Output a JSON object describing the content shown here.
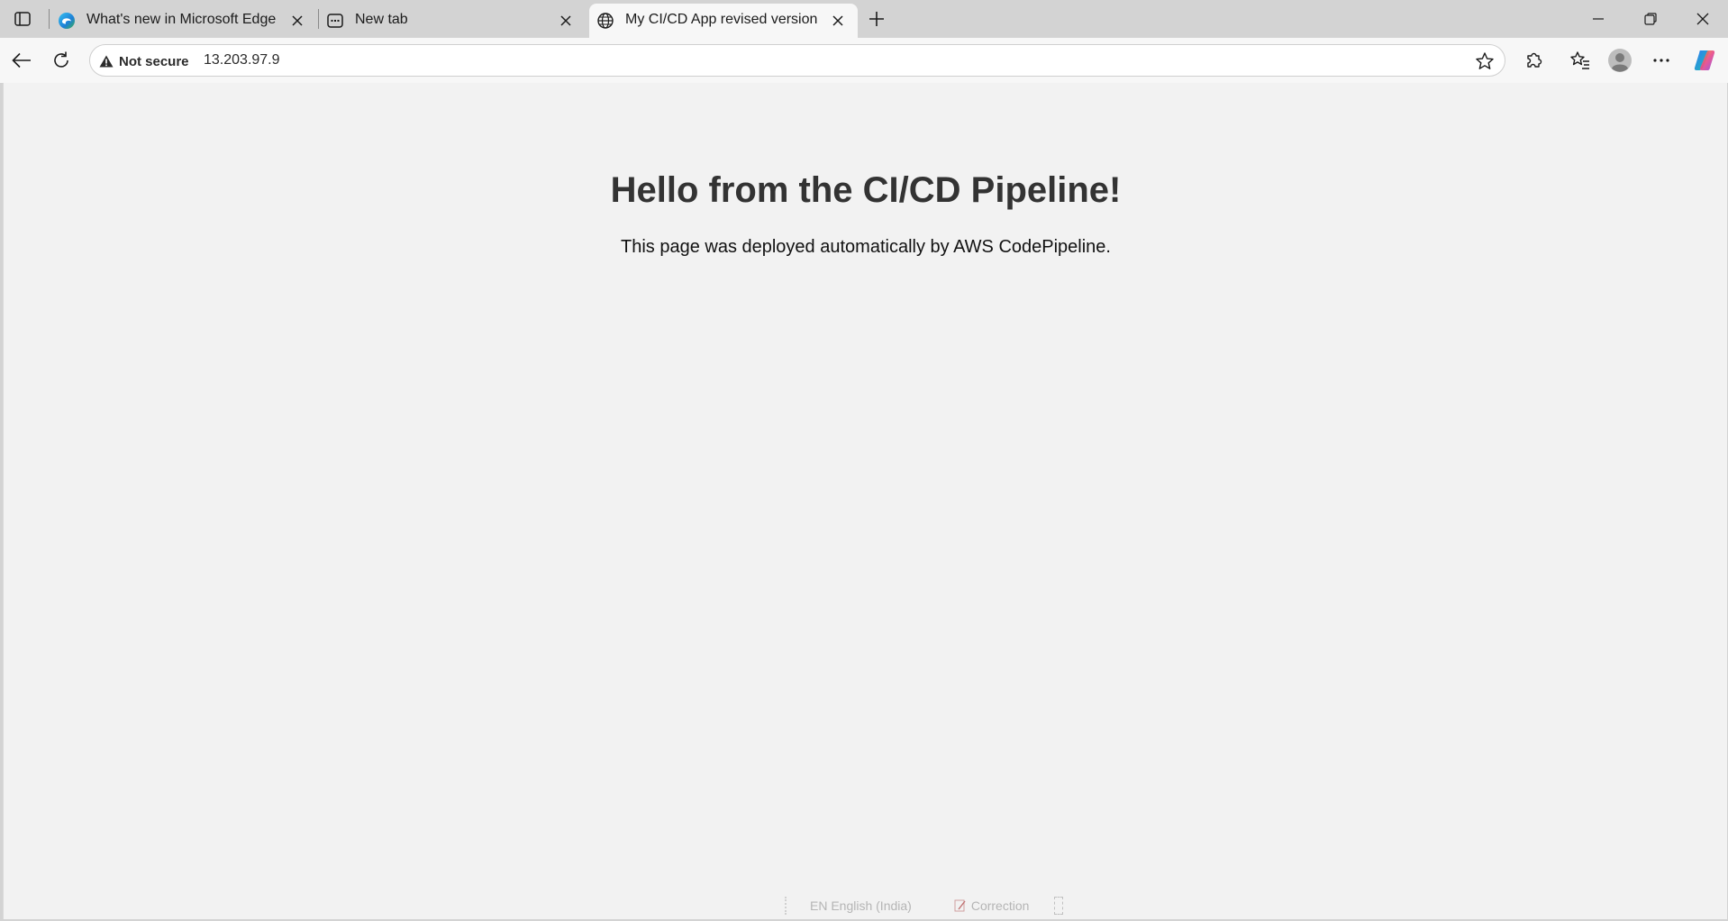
{
  "browser": {
    "tabs": [
      {
        "title": "What's new in Microsoft Edge",
        "icon": "edge-logo-icon",
        "active": false
      },
      {
        "title": "New tab",
        "icon": "new-tab-page-icon",
        "active": false
      },
      {
        "title": "My CI/CD App revised version",
        "icon": "globe-icon",
        "active": true
      }
    ],
    "address": {
      "security_label": "Not secure",
      "url": "13.203.97.9"
    },
    "colors": {
      "tabstrip": "#d3d3d3",
      "toolbar": "#f7f7f7",
      "page_background": "#f2f2f2",
      "heading": "#333333"
    }
  },
  "page": {
    "heading": "Hello from the CI/CD Pipeline!",
    "text": "This page was deployed automatically by AWS CodePipeline."
  },
  "ime": {
    "language": "EN English (India)",
    "correction_label": "Correction"
  }
}
